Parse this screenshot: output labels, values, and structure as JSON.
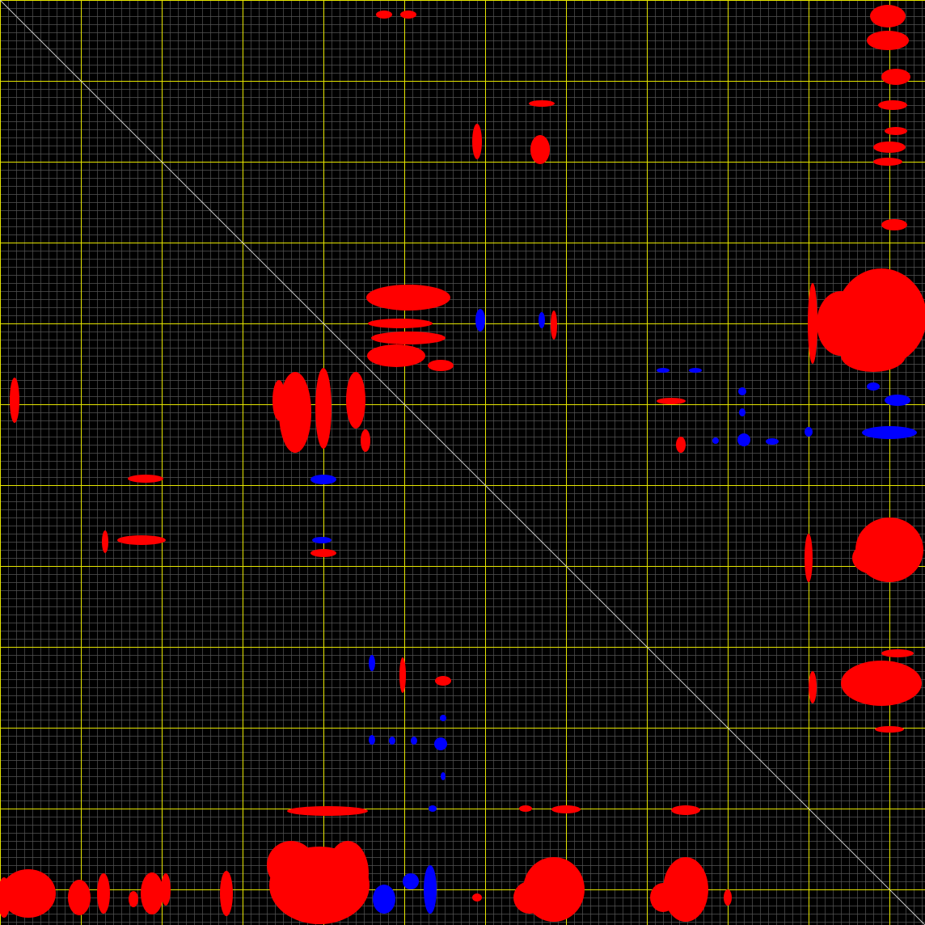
{
  "diagram": {
    "type": "contact-map",
    "background_color": "#000000",
    "minor_grid_color": "#555555",
    "major_grid_color": "#e6e600",
    "diagonal_color": "#c8c8c8",
    "positive_color": "#ff0000",
    "negative_color": "#0000ff",
    "minor_grid_interval": 10,
    "major_grid_interval": 100,
    "diagonal_visible": true
  }
}
